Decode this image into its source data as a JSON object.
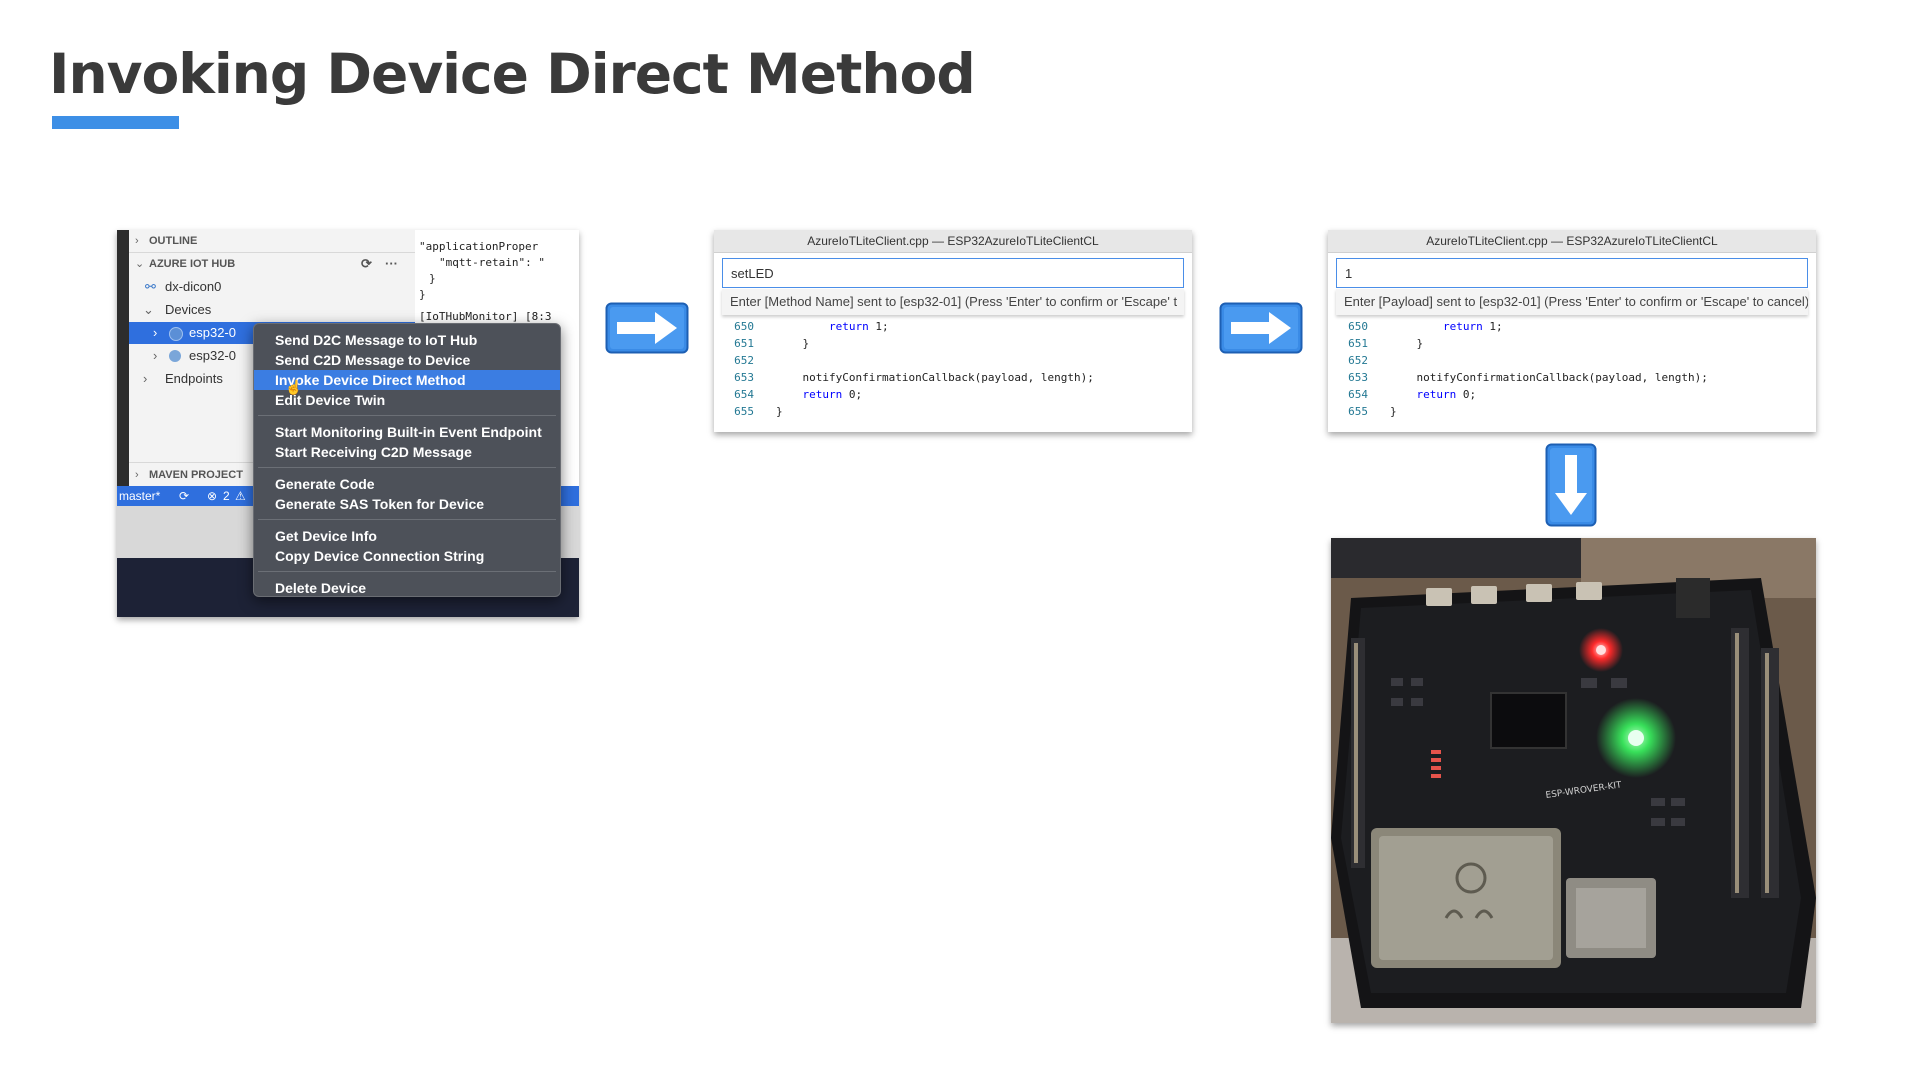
{
  "slide": {
    "title": "Invoking Device Direct Method",
    "accent_color": "#3d8fe6"
  },
  "vscode_sidebar": {
    "sections": [
      "OUTLINE",
      "AZURE IOT HUB",
      "MAVEN PROJECT"
    ],
    "hub_name": "dx-dicon0",
    "devices_label": "Devices",
    "device_1": "esp32-0",
    "device_2": "esp32-0",
    "endpoints_label": "Endpoints",
    "code_lines": [
      "\"applicationProper",
      "\"mqtt-retain\": \"",
      "}",
      "}",
      "[IoTHubMonitor] [8:3"
    ],
    "status_branch": "master*",
    "status_errors": "2"
  },
  "context_menu": {
    "items": [
      "Send D2C Message to IoT Hub",
      "Send C2D Message to Device",
      "Invoke Device Direct Method",
      "Edit Device Twin",
      "Start Monitoring Built-in Event Endpoint",
      "Start Receiving C2D Message",
      "Generate Code",
      "Generate SAS Token for Device",
      "Get Device Info",
      "Copy Device Connection String",
      "Delete Device"
    ],
    "highlighted": "Invoke Device Direct Method"
  },
  "method_window": {
    "title": "AzureIoTLiteClient.cpp — ESP32AzureIoTLiteClientCL",
    "input_value": "setLED",
    "hint": "Enter [Method Name] sent to [esp32-01] (Press 'Enter' to confirm or 'Escape' t",
    "lines": [
      {
        "num": "650",
        "code": "        return 1;"
      },
      {
        "num": "651",
        "code": "    }"
      },
      {
        "num": "652",
        "code": ""
      },
      {
        "num": "653",
        "code": "    notifyConfirmationCallback(payload, length);"
      },
      {
        "num": "654",
        "code": "    return 0;"
      },
      {
        "num": "655",
        "code": "}"
      }
    ]
  },
  "payload_window": {
    "title": "AzureIoTLiteClient.cpp — ESP32AzureIoTLiteClientCL",
    "input_value": "1",
    "hint": "Enter [Payload] sent to [esp32-01] (Press 'Enter' to confirm or 'Escape' to cancel)",
    "lines": [
      {
        "num": "650",
        "code": "        return 1;"
      },
      {
        "num": "651",
        "code": "    }"
      },
      {
        "num": "652",
        "code": ""
      },
      {
        "num": "653",
        "code": "    notifyConfirmationCallback(payload, length);"
      },
      {
        "num": "654",
        "code": "    return 0;"
      },
      {
        "num": "655",
        "code": "}"
      }
    ]
  },
  "board_photo": {
    "silkscreen": "ESP-WROVER-KIT",
    "led_color": "#38e05a"
  }
}
